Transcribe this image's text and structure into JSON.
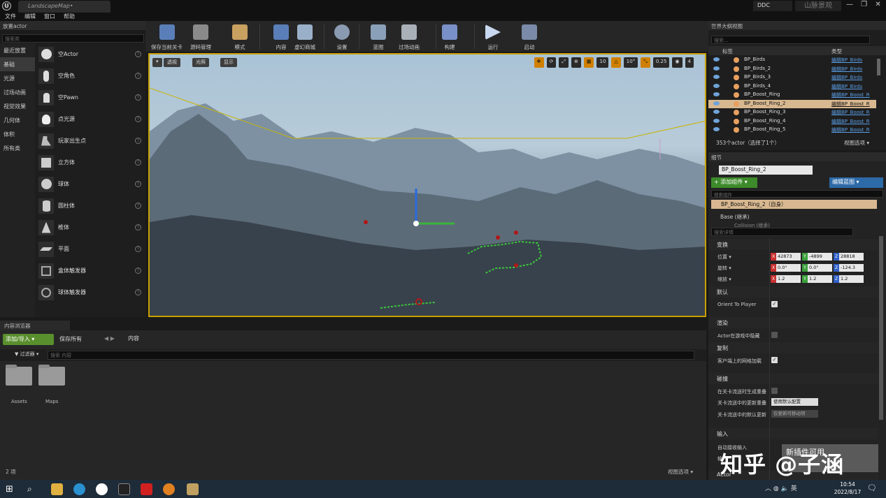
{
  "window": {
    "doc_tab": "LandscapeMap•",
    "ddc": "DDC",
    "project": "山脉景观",
    "controls": "— ❐ ✕"
  },
  "menu": [
    "文件",
    "编辑",
    "窗口",
    "帮助"
  ],
  "place_panel": {
    "tab": "放置actor",
    "search_placeholder": "搜索类",
    "categories": [
      "最近放置",
      "基础",
      "光源",
      "过场动画",
      "视觉效果",
      "几何体",
      "体积",
      "所有类"
    ],
    "selected_category": "基础",
    "items": [
      "空Actor",
      "空角色",
      "空Pawn",
      "点光源",
      "玩家出生点",
      "立方体",
      "球体",
      "圆柱体",
      "椎体",
      "平面",
      "盒体触发器",
      "球体触发器"
    ],
    "help": "?"
  },
  "toolbar": {
    "buttons": [
      "保存当前关卡",
      "源码管理",
      "模式",
      "内容",
      "虚幻商城",
      "设置",
      "蓝图",
      "过场动画",
      "构建",
      "运行",
      "启动"
    ]
  },
  "viewport": {
    "perspective": "透视",
    "lit": "光照",
    "show": "显示",
    "grid_snap": "10",
    "rot_snap": "10°",
    "scale_snap": "0.25",
    "cam_speed": "4"
  },
  "content_browser": {
    "tab": "内容浏览器",
    "add_import": "添加/导入 ▾",
    "save_all": "保存所有",
    "nav": "◀ ▶",
    "breadcrumb": "内容",
    "filters": "▼ 过滤器 ▾",
    "search_placeholder": "搜索 内容",
    "folders": [
      "Assets",
      "Maps"
    ],
    "item_count": "2 项",
    "view_options": "视图选项 ▾"
  },
  "outliner": {
    "tab": "世界大纲视图",
    "search_placeholder": "搜索...",
    "col_label": "标签",
    "col_type": "类型",
    "rows": [
      {
        "name": "BP_Birds",
        "type": "编辑BP_Birds"
      },
      {
        "name": "BP_Birds_2",
        "type": "编辑BP_Birds"
      },
      {
        "name": "BP_Birds_3",
        "type": "编辑BP_Birds"
      },
      {
        "name": "BP_Birds_4",
        "type": "编辑BP_Birds"
      },
      {
        "name": "BP_Boost_Ring",
        "type": "编辑BP_Boost_R"
      },
      {
        "name": "BP_Boost_Ring_2",
        "type": "编辑BP_Boost_R"
      },
      {
        "name": "BP_Boost_Ring_3",
        "type": "编辑BP_Boost_R"
      },
      {
        "name": "BP_Boost_Ring_4",
        "type": "编辑BP_Boost_R"
      },
      {
        "name": "BP_Boost_Ring_5",
        "type": "编辑BP_Boost_R"
      }
    ],
    "selected_index": 5,
    "footer": "353个actor（选择了1个）",
    "view_options": "视图选项 ▾"
  },
  "details": {
    "tab": "细节",
    "object_name": "BP_Boost_Ring_2",
    "add_component": "+ 添加组件 ▾",
    "edit_blueprint": "编辑蓝图 ▾",
    "component_search_placeholder": "搜索组件",
    "component_root": "BP_Boost_Ring_2（自身）",
    "component_base": "Base (继承)",
    "component_collision": "Collision (继承)",
    "detail_search_placeholder": "搜索详情",
    "transform": {
      "section": "变换",
      "location_label": "位置 ▾",
      "location": [
        "42873",
        "-4899",
        "28818"
      ],
      "rotation_label": "旋转 ▾",
      "rotation": [
        "0.0°",
        "0.0°",
        "-124.3"
      ],
      "scale_label": "缩放 ▾",
      "scale": [
        "1.2",
        "1.2",
        "1.2"
      ]
    },
    "default_section": "默认",
    "orient_to_player": "Orient To Player",
    "render_section": "渲染",
    "hidden_in_game": "Actor在游戏中隐藏",
    "replication_section": "复制",
    "net_load_on_client": "客户端上的网格加载",
    "collision_section": "碰撞",
    "gen_overlap_seamless": "在关卡流送时生成重叠",
    "update_overlap_streaming": "关卡流送中的更新重叠",
    "update_overlap_value": "使用默认配置",
    "default_update_overlap": "关卡流送中的默认更新",
    "default_update_value": "仅更新可移动项",
    "input_section": "输入",
    "auto_receive_input": "自动接收输入",
    "input_extra": "输",
    "actor_section": "Actor",
    "watermark_line": "新插件可用"
  },
  "overlay_watermark": "知乎 @子涵",
  "taskbar": {
    "ime": "英",
    "time": "10:54",
    "date": "2022/8/17"
  }
}
